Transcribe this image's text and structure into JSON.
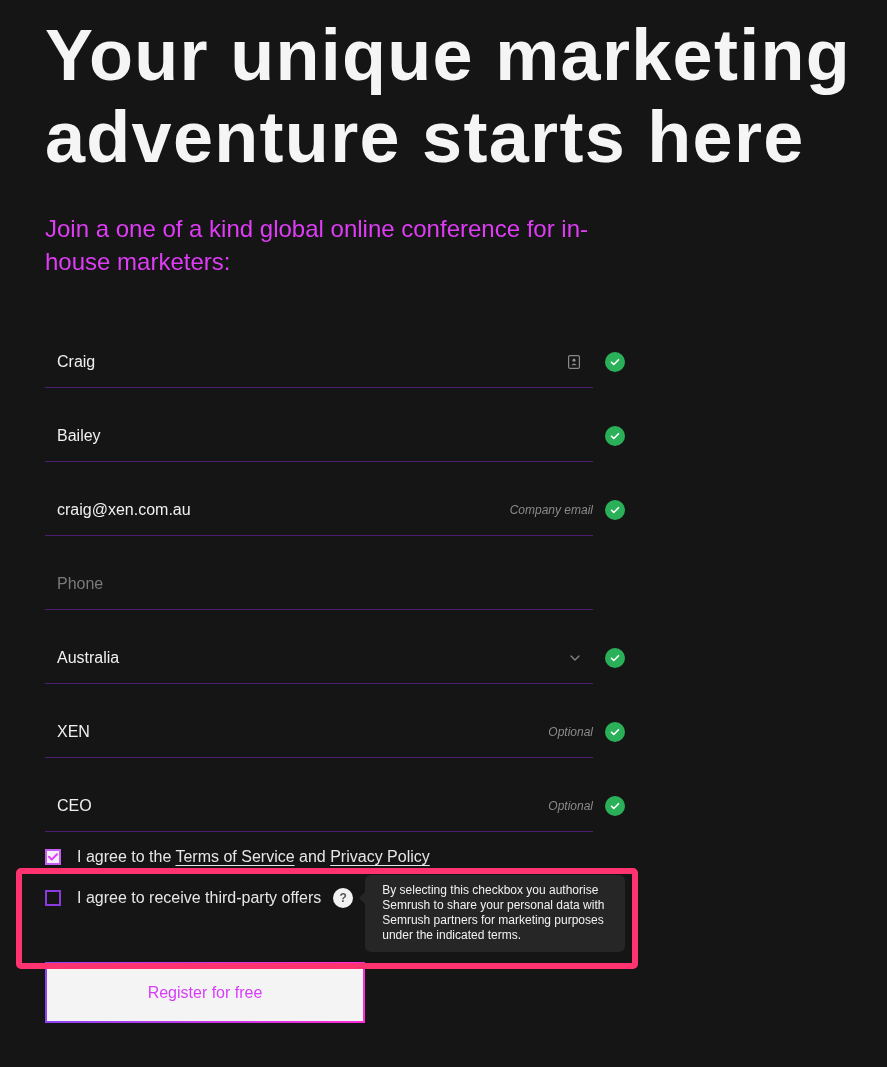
{
  "heading": "Your unique marketing adventure starts here",
  "subheading": "Join a one of a kind global online conference for in-house marketers:",
  "fields": [
    {
      "kind": "text",
      "value": "Craig",
      "autofill": true,
      "valid": true
    },
    {
      "kind": "text",
      "value": "Bailey",
      "autofill": false,
      "valid": true
    },
    {
      "kind": "text",
      "value": "craig@xen.com.au",
      "hint": "Company email",
      "autofill": false,
      "valid": true
    },
    {
      "kind": "text",
      "placeholder": "Phone",
      "autofill": false,
      "valid": false
    },
    {
      "kind": "select",
      "value": "Australia",
      "autofill": false,
      "valid": true
    },
    {
      "kind": "text",
      "value": "XEN",
      "hint": "Optional",
      "autofill": false,
      "valid": true
    },
    {
      "kind": "text",
      "value": "CEO",
      "hint": "Optional",
      "autofill": false,
      "valid": true
    }
  ],
  "consents": [
    {
      "checked": true,
      "highlighted": false,
      "label_parts": [
        {
          "kind": "text",
          "text": "I agree to the "
        },
        {
          "kind": "link",
          "text": "Terms of Service"
        },
        {
          "kind": "text",
          "text": " and "
        },
        {
          "kind": "link",
          "text": "Privacy Policy"
        }
      ]
    },
    {
      "checked": false,
      "highlighted": true,
      "label_parts": [
        {
          "kind": "text",
          "text": "I agree to receive third-party offers"
        }
      ],
      "help": "?",
      "tooltip": "By selecting this checkbox you authorise Semrush to share your personal data with Semrush partners for marketing purposes under the indicated terms."
    }
  ],
  "submit_button": "Register for free"
}
